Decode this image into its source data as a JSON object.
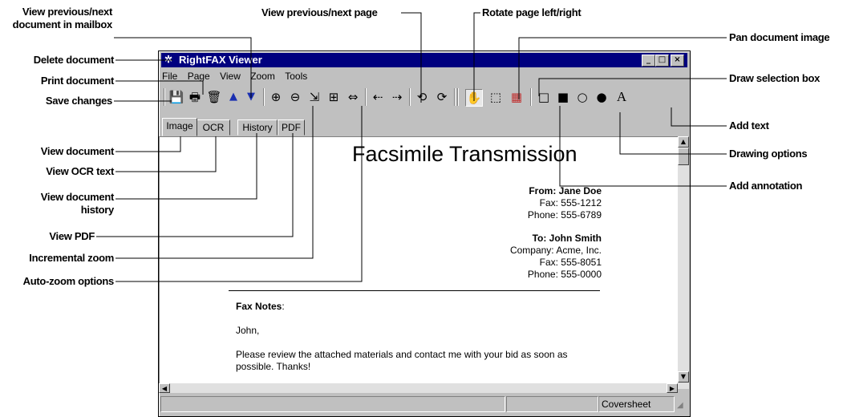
{
  "window": {
    "title": "RightFAX Viewer",
    "controls": {
      "minimize": "_",
      "maximize": "□",
      "close": "×"
    }
  },
  "menu": [
    "File",
    "Page",
    "View",
    "Zoom",
    "Tools"
  ],
  "toolbar": {
    "save": "💾",
    "print": "🖶",
    "delete": "🗑",
    "prev_doc": "▲",
    "next_doc": "▼",
    "zoom_in": "⊕",
    "zoom_out": "⊖",
    "auto_zoom_1": "⇲",
    "auto_zoom_2": "⊞",
    "auto_zoom_3": "⇔",
    "prev_page": "⇠",
    "next_page": "⇢",
    "rotate_left": "⟲",
    "rotate_right": "⟳",
    "pan": "✋",
    "select_box": "⬚",
    "annotation": "▦",
    "rect_outline": "□",
    "rect_filled": "■",
    "ellipse_outline": "○",
    "ellipse_filled": "●",
    "text_tool": "A"
  },
  "tabs": [
    "Image",
    "OCR",
    "History",
    "PDF"
  ],
  "document": {
    "title": "Facsimile Transmission",
    "from_label": "From: Jane Doe",
    "from_fax": "Fax: 555-1212",
    "from_phone": "Phone: 555-6789",
    "to_label": "To: John Smith",
    "to_company": "Company: Acme, Inc.",
    "to_fax": "Fax: 555-8051",
    "to_phone": "Phone: 555-0000",
    "notes_label": "Fax Notes",
    "notes_colon": ":",
    "greeting": "John,",
    "message_line1": "Please review the attached materials and contact me with your bid as soon as",
    "message_line2": "possible. Thanks!"
  },
  "status_bar": {
    "page_type": "Coversheet"
  },
  "callouts": {
    "view_prev_next_doc_1": "View previous/next",
    "view_prev_next_doc_2": "document in mailbox",
    "delete_document": "Delete document",
    "print_document": "Print document",
    "save_changes": "Save changes",
    "view_document": "View document",
    "view_ocr": "View OCR text",
    "view_history_1": "View document",
    "view_history_2": "history",
    "view_pdf": "View PDF",
    "incremental_zoom": "Incremental zoom",
    "auto_zoom": "Auto-zoom options",
    "view_prev_next_page": "View previous/next page",
    "rotate_page": "Rotate page left/right",
    "pan_image": "Pan document image",
    "draw_selection": "Draw selection box",
    "add_text": "Add text",
    "drawing_options": "Drawing options",
    "add_annotation": "Add annotation"
  }
}
